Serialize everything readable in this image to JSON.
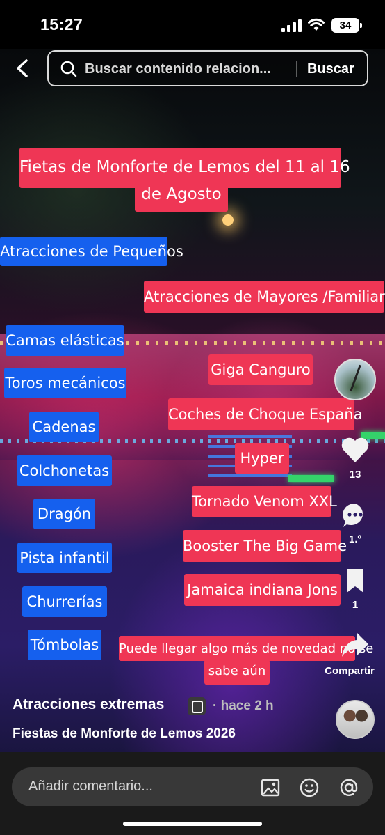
{
  "status": {
    "time": "15:27",
    "battery": "34"
  },
  "search": {
    "placeholder": "Buscar contenido relacion...",
    "submit": "Buscar"
  },
  "overlay": {
    "title_line1": "Fietas de Monforte de Lemos del 11 al 16",
    "title_line2": "de Agosto",
    "kids_header": "Atracciones de Pequeños",
    "adults_header": "Atracciones de Mayores /Familiares",
    "kids": [
      "Camas elásticas",
      "Toros mecánicos",
      "Cadenas",
      "Colchonetas",
      "Dragón",
      "Pista infantil",
      "Churrerías",
      "Tómbolas"
    ],
    "adults": [
      "Giga Canguro",
      "Coches de Choque España",
      "Hyper",
      "Tornado Venom XXL",
      "Booster The Big Game",
      "Jamaica  indiana Jons"
    ],
    "note_line1": "Puede llegar algo más de novedad no se",
    "note_line2": "sabe aún"
  },
  "actions": {
    "likes": "13",
    "comments": "1.º",
    "saves": "1",
    "share": "Compartir"
  },
  "post": {
    "author": "Atracciones extremas",
    "time": "· hace 2 h",
    "caption": "Fiestas de Monforte de Lemos 2026"
  },
  "comment": {
    "placeholder": "Añadir comentario..."
  },
  "colors": {
    "red_label": "#ef3655",
    "blue_label": "#1560ee"
  }
}
